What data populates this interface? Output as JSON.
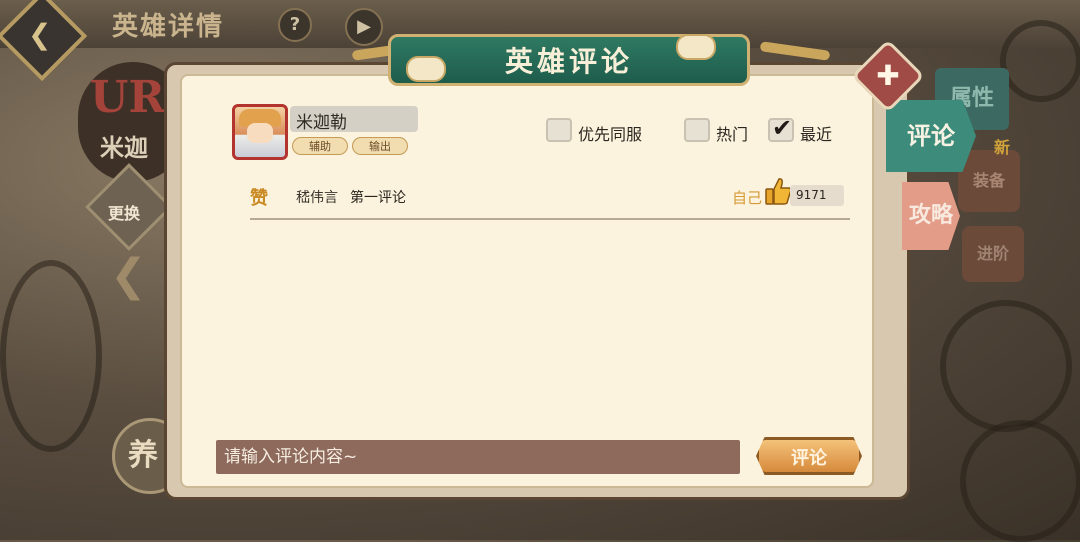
{
  "background": {
    "title": "英雄详情",
    "help_icon": "?",
    "play_icon": "▶",
    "back_icon": "❮",
    "rarity": "UR",
    "hero_name_partial": "米迦",
    "swap_label": "更换",
    "left_arrow": "❮",
    "train_label": "养"
  },
  "dialog": {
    "title": "英雄评论",
    "close_icon": "✚"
  },
  "hero": {
    "name": "米迦勒",
    "roles": [
      "辅助",
      "输出"
    ]
  },
  "filters": [
    {
      "label": "优先同服",
      "checked": false
    },
    {
      "label": "热门",
      "checked": false
    },
    {
      "label": "最近",
      "checked": true
    }
  ],
  "comments": [
    {
      "badge": "赞",
      "user": "嵇伟言",
      "text": "第一评论",
      "self": "自己",
      "likes": "9171"
    }
  ],
  "input": {
    "placeholder": "请输入评论内容~"
  },
  "submit_label": "评论",
  "side_tabs": {
    "attributes": "属性",
    "comment": "评论",
    "guide": "攻略",
    "equipment": "装备",
    "new_badge": "新",
    "advance": "进阶"
  },
  "colors": {
    "banner": "#2f7a63",
    "panel": "#fbf3de",
    "comment_tab": "#3d8c7b",
    "guide_tab": "#e39c88",
    "input_bg": "#8d6a5c",
    "submit": "#e7a457"
  }
}
